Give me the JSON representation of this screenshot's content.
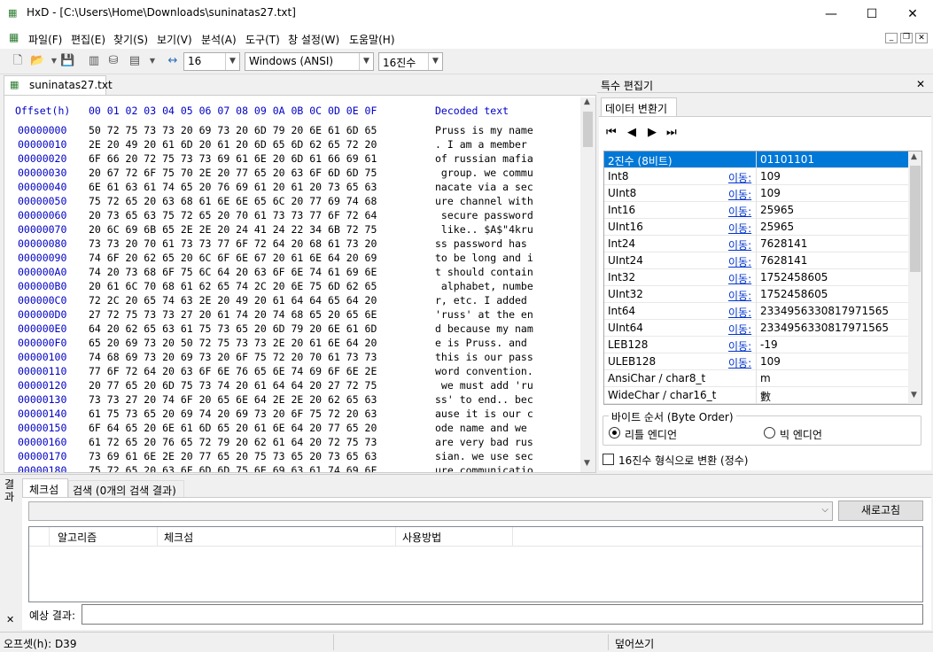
{
  "window": {
    "title": "HxD - [C:\\Users\\Home\\Downloads\\suninatas27.txt]",
    "minimize": "—",
    "maximize": "☐",
    "close": "✕"
  },
  "menu": [
    "파일(F)",
    "편집(E)",
    "찾기(S)",
    "보기(V)",
    "분석(A)",
    "도구(T)",
    "창 설정(W)",
    "도움말(H)"
  ],
  "toolbar": {
    "bytes_per_row": "16",
    "charset": "Windows (ANSI)",
    "offset_base": "16진수"
  },
  "editor": {
    "tab": "suninatas27.txt",
    "header_offset": "Offset(h)",
    "header_bytes": "00 01 02 03 04 05 06 07 08 09 0A 0B 0C 0D 0E 0F",
    "header_text": "Decoded text",
    "rows": [
      {
        "o": "00000000",
        "h": "50 72 75 73 73 20 69 73 20 6D 79 20 6E 61 6D 65",
        "t": "Pruss is my name"
      },
      {
        "o": "00000010",
        "h": "2E 20 49 20 61 6D 20 61 20 6D 65 6D 62 65 72 20",
        "t": ". I am a member "
      },
      {
        "o": "00000020",
        "h": "6F 66 20 72 75 73 73 69 61 6E 20 6D 61 66 69 61",
        "t": "of russian mafia"
      },
      {
        "o": "00000030",
        "h": "20 67 72 6F 75 70 2E 20 77 65 20 63 6F 6D 6D 75",
        "t": " group. we commu"
      },
      {
        "o": "00000040",
        "h": "6E 61 63 61 74 65 20 76 69 61 20 61 20 73 65 63",
        "t": "nacate via a sec"
      },
      {
        "o": "00000050",
        "h": "75 72 65 20 63 68 61 6E 6E 65 6C 20 77 69 74 68",
        "t": "ure channel with"
      },
      {
        "o": "00000060",
        "h": "20 73 65 63 75 72 65 20 70 61 73 73 77 6F 72 64",
        "t": " secure password"
      },
      {
        "o": "00000070",
        "h": "20 6C 69 6B 65 2E 2E 20 24 41 24 22 34 6B 72 75",
        "t": " like.. $A$\"4kru"
      },
      {
        "o": "00000080",
        "h": "73 73 20 70 61 73 73 77 6F 72 64 20 68 61 73 20",
        "t": "ss password has "
      },
      {
        "o": "00000090",
        "h": "74 6F 20 62 65 20 6C 6F 6E 67 20 61 6E 64 20 69",
        "t": "to be long and i"
      },
      {
        "o": "000000A0",
        "h": "74 20 73 68 6F 75 6C 64 20 63 6F 6E 74 61 69 6E",
        "t": "t should contain"
      },
      {
        "o": "000000B0",
        "h": "20 61 6C 70 68 61 62 65 74 2C 20 6E 75 6D 62 65",
        "t": " alphabet, numbe"
      },
      {
        "o": "000000C0",
        "h": "72 2C 20 65 74 63 2E 20 49 20 61 64 64 65 64 20",
        "t": "r, etc. I added "
      },
      {
        "o": "000000D0",
        "h": "27 72 75 73 73 27 20 61 74 20 74 68 65 20 65 6E",
        "t": "'russ' at the en"
      },
      {
        "o": "000000E0",
        "h": "64 20 62 65 63 61 75 73 65 20 6D 79 20 6E 61 6D",
        "t": "d because my nam"
      },
      {
        "o": "000000F0",
        "h": "65 20 69 73 20 50 72 75 73 73 2E 20 61 6E 64 20",
        "t": "e is Pruss. and "
      },
      {
        "o": "00000100",
        "h": "74 68 69 73 20 69 73 20 6F 75 72 20 70 61 73 73",
        "t": "this is our pass"
      },
      {
        "o": "00000110",
        "h": "77 6F 72 64 20 63 6F 6E 76 65 6E 74 69 6F 6E 2E",
        "t": "word convention."
      },
      {
        "o": "00000120",
        "h": "20 77 65 20 6D 75 73 74 20 61 64 64 20 27 72 75",
        "t": " we must add 'ru"
      },
      {
        "o": "00000130",
        "h": "73 73 27 20 74 6F 20 65 6E 64 2E 2E 20 62 65 63",
        "t": "ss' to end.. bec"
      },
      {
        "o": "00000140",
        "h": "61 75 73 65 20 69 74 20 69 73 20 6F 75 72 20 63",
        "t": "ause it is our c"
      },
      {
        "o": "00000150",
        "h": "6F 64 65 20 6E 61 6D 65 20 61 6E 64 20 77 65 20",
        "t": "ode name and we "
      },
      {
        "o": "00000160",
        "h": "61 72 65 20 76 65 72 79 20 62 61 64 20 72 75 73",
        "t": "are very bad rus"
      },
      {
        "o": "00000170",
        "h": "73 69 61 6E 2E 20 77 65 20 75 73 65 20 73 65 63",
        "t": "sian. we use sec"
      },
      {
        "o": "00000180",
        "h": "75 72 65 20 63 6F 6D 6D 75 6E 69 63 61 74 69 6F",
        "t": "ure communicatio"
      }
    ]
  },
  "inspector": {
    "panel_title": "특수 편집기",
    "close": "✕",
    "tab": "데이터 변환기",
    "goto": "이동:",
    "rows": [
      {
        "n": "2진수 (8비트)",
        "v": "01101101"
      },
      {
        "n": "Int8",
        "v": "109"
      },
      {
        "n": "UInt8",
        "v": "109"
      },
      {
        "n": "Int16",
        "v": "25965"
      },
      {
        "n": "UInt16",
        "v": "25965"
      },
      {
        "n": "Int24",
        "v": "7628141"
      },
      {
        "n": "UInt24",
        "v": "7628141"
      },
      {
        "n": "Int32",
        "v": "1752458605"
      },
      {
        "n": "UInt32",
        "v": "1752458605"
      },
      {
        "n": "Int64",
        "v": "2334956330817971565"
      },
      {
        "n": "UInt64",
        "v": "2334956330817971565"
      },
      {
        "n": "LEB128",
        "v": "-19"
      },
      {
        "n": "ULEB128",
        "v": "109"
      },
      {
        "n": "AnsiChar / char8_t",
        "v": "m"
      },
      {
        "n": "WideChar / char16_t",
        "v": "數"
      }
    ],
    "byte_order_label": "바이트 순서 (Byte Order)",
    "little_endian": "리틀 엔디언",
    "big_endian": "빅 엔디언",
    "hex_checkbox": "16진수 형식으로 변환 (정수)"
  },
  "results": {
    "side_label": "결과",
    "close": "✕",
    "tab_checksum": "체크섬",
    "tab_search": "검색 (0개의 검색 결과)",
    "refresh": "새로고침",
    "col_algo": "알고리즘",
    "col_checksum": "체크섬",
    "col_usage": "사용방법",
    "expected_label": "예상 결과:"
  },
  "status": {
    "offset": "오프셋(h): D39",
    "mode": "덮어쓰기"
  }
}
